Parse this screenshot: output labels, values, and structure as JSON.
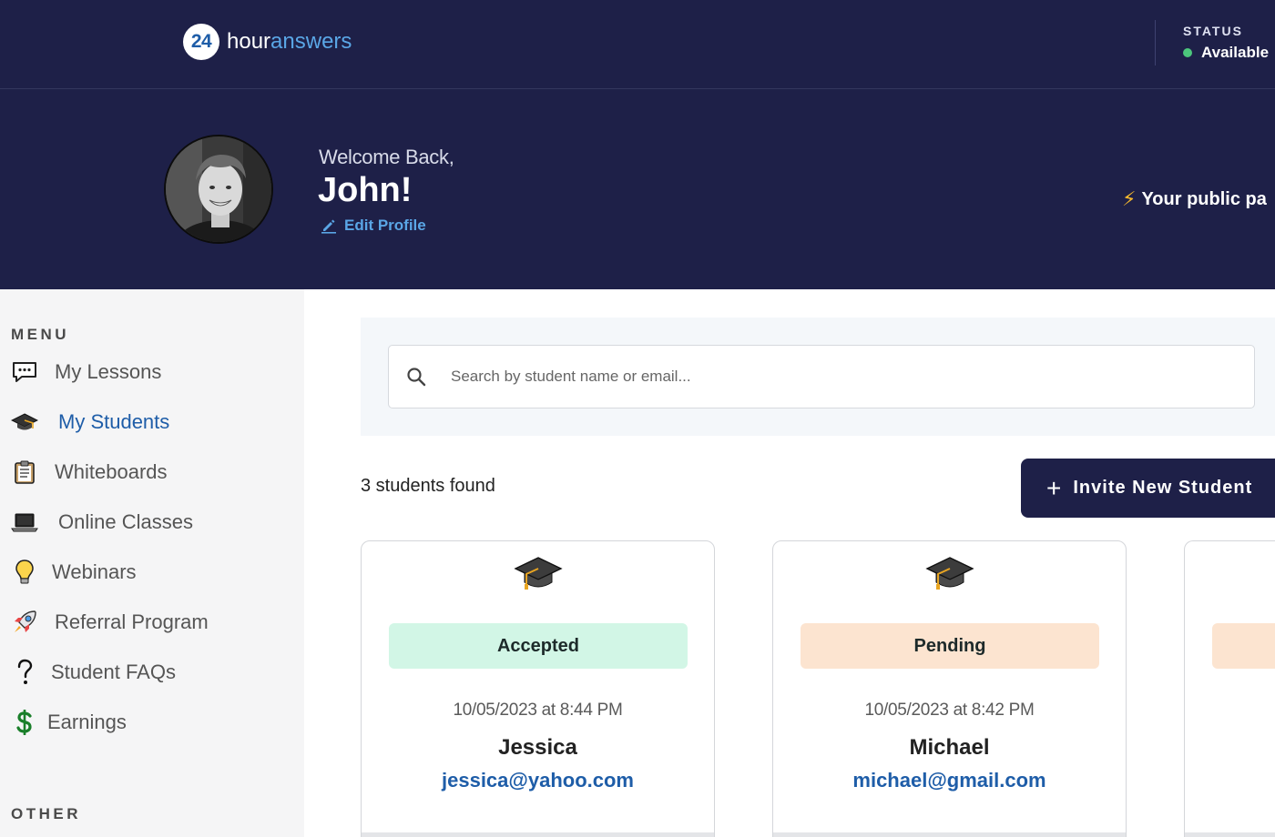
{
  "header": {
    "logo_number": "24",
    "logo_word_1": "hour",
    "logo_word_2": "answers",
    "status_label": "STATUS",
    "status_value": "Available",
    "status_color": "#4cc67c"
  },
  "hero": {
    "welcome": "Welcome Back,",
    "name": "John!",
    "edit_profile": "Edit Profile",
    "public_page": "Your public pa"
  },
  "sidebar": {
    "menu_label": "MENU",
    "other_label": "OTHER",
    "items": [
      {
        "label": "My Lessons",
        "icon": "speech-bubble-icon",
        "active": false
      },
      {
        "label": "My Students",
        "icon": "graduation-cap-icon",
        "active": true
      },
      {
        "label": "Whiteboards",
        "icon": "clipboard-icon",
        "active": false
      },
      {
        "label": "Online Classes",
        "icon": "laptop-icon",
        "active": false
      },
      {
        "label": "Webinars",
        "icon": "lightbulb-icon",
        "active": false
      },
      {
        "label": "Referral Program",
        "icon": "rocket-icon",
        "active": false
      },
      {
        "label": "Student FAQs",
        "icon": "question-mark-icon",
        "active": false
      },
      {
        "label": "Earnings",
        "icon": "dollar-sign-icon",
        "active": false
      }
    ]
  },
  "main": {
    "search_placeholder": "Search by student name or email...",
    "count_text": "3 students found",
    "invite_label": "Invite New Student",
    "students": [
      {
        "status": "Accepted",
        "date": "10/05/2023 at 8:44 PM",
        "name": "Jessica",
        "email": "jessica@yahoo.com"
      },
      {
        "status": "Pending",
        "date": "10/05/2023 at 8:42 PM",
        "name": "Michael",
        "email": "michael@gmail.com"
      }
    ]
  },
  "colors": {
    "navy": "#1e2048",
    "link_blue": "#1e5da8",
    "accepted_bg": "#d2f6e6",
    "pending_bg": "#fce4d0"
  }
}
